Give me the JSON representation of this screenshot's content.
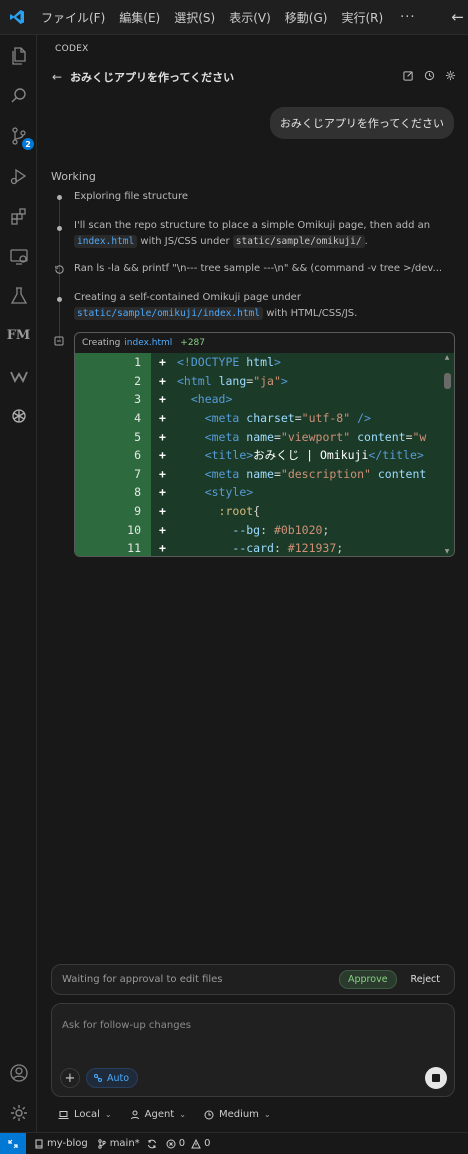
{
  "titlebar": {
    "menu": [
      "ファイル(F)",
      "編集(E)",
      "選択(S)",
      "表示(V)",
      "移動(G)",
      "実行(R)"
    ],
    "more": "···",
    "back_icon": "arrow-left-icon"
  },
  "activitybar": {
    "items": [
      {
        "name": "explorer-icon"
      },
      {
        "name": "search-icon"
      },
      {
        "name": "source-control-icon",
        "badge": "2"
      },
      {
        "name": "run-debug-icon"
      },
      {
        "name": "extensions-icon"
      },
      {
        "name": "remote-explorer-icon"
      },
      {
        "name": "testing-icon"
      },
      {
        "name": "fm-icon",
        "text": "FM"
      },
      {
        "name": "windsurf-icon"
      },
      {
        "name": "openai-icon"
      }
    ],
    "bottom": [
      {
        "name": "account-icon"
      },
      {
        "name": "settings-gear-icon"
      }
    ]
  },
  "panel": {
    "label": "CODEX",
    "title": "おみくじアプリを作ってください",
    "user_message": "おみくじアプリを作ってください",
    "status": "Working",
    "steps": {
      "s1": "Exploring file structure",
      "s2_a": "I'll scan the repo structure to place a simple Omikuji page, then add an",
      "s2_chip1": "index.html",
      "s2_b": "with JS/CSS under",
      "s2_chip2": "static/sample/omikuji/",
      "s2_c": ".",
      "s3": "Ran ls -la && printf \"\\n--- tree sample ---\\n\" && (command -v tree >/dev...",
      "s4_a": "Creating a self-contained Omikuji page under",
      "s4_chip": "static/sample/omikuji/index.html",
      "s4_b": "with HTML/CSS/JS."
    },
    "code_card": {
      "action": "Creating",
      "file": "index.html",
      "added": "+287"
    }
  },
  "approval": {
    "text": "Waiting for approval to edit files",
    "approve": "Approve",
    "reject": "Reject"
  },
  "composer": {
    "placeholder": "Ask for follow-up changes",
    "plus": "+",
    "auto": "Auto"
  },
  "options": {
    "local": "Local",
    "agent": "Agent",
    "medium": "Medium"
  },
  "statusbar": {
    "repo": "my-blog",
    "branch": "main*",
    "errors": "0",
    "warnings": "0"
  },
  "colors": {
    "accent": "#0078d4",
    "link": "#4daafc",
    "added_green": "#89d185",
    "diff_bg": "#1c3a28",
    "gutter_bg": "#2d6b3f"
  }
}
